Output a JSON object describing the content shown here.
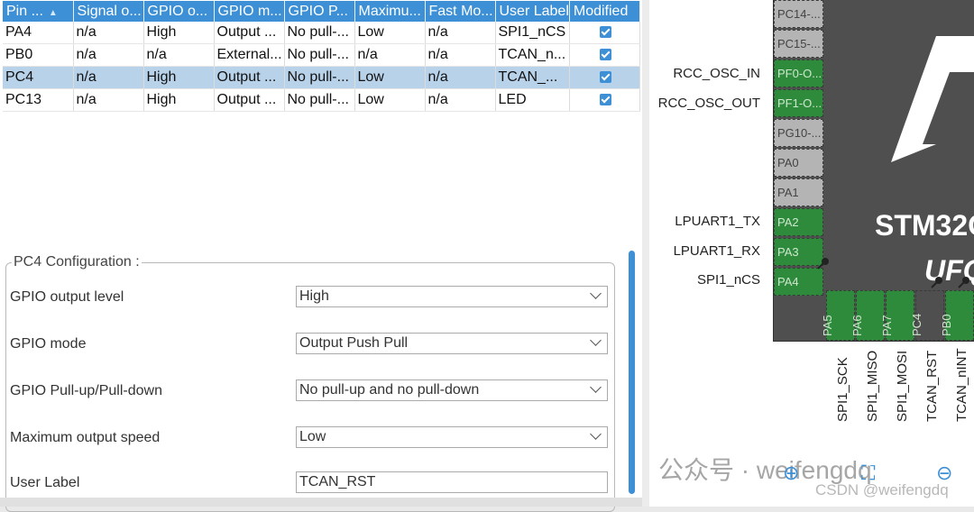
{
  "table": {
    "headers": [
      "Pin ...",
      "Signal o...",
      "GPIO o...",
      "GPIO m...",
      "GPIO P...",
      "Maximu...",
      "Fast Mo...",
      "User Label",
      "Modified"
    ],
    "rows": [
      {
        "pin": "PA4",
        "signal": "n/a",
        "out": "High",
        "mode": "Output ...",
        "pull": "No pull-...",
        "max": "Low",
        "fast": "n/a",
        "label": "SPI1_nCS"
      },
      {
        "pin": "PB0",
        "signal": "n/a",
        "out": "n/a",
        "mode": "External...",
        "pull": "No pull-...",
        "max": "n/a",
        "fast": "n/a",
        "label": "TCAN_n..."
      },
      {
        "pin": "PC4",
        "signal": "n/a",
        "out": "High",
        "mode": "Output ...",
        "pull": "No pull-...",
        "max": "Low",
        "fast": "n/a",
        "label": "TCAN_..."
      },
      {
        "pin": "PC13",
        "signal": "n/a",
        "out": "High",
        "mode": "Output ...",
        "pull": "No pull-...",
        "max": "Low",
        "fast": "n/a",
        "label": "LED"
      }
    ]
  },
  "config": {
    "title": "PC4 Configuration :",
    "fields": [
      {
        "label": "GPIO output level",
        "value": "High"
      },
      {
        "label": "GPIO mode",
        "value": "Output Push Pull"
      },
      {
        "label": "GPIO Pull-up/Pull-down",
        "value": "No pull-up and no pull-down"
      },
      {
        "label": "Maximum output speed",
        "value": "Low"
      },
      {
        "label": "User Label",
        "value": "TCAN_RST"
      }
    ]
  },
  "chip": {
    "name": "STM32G",
    "name2": "UFQ",
    "left_pins": [
      "PC14-...",
      "PC15-...",
      "PF0-O...",
      "PF1-O...",
      "PG10-...",
      "PA0",
      "PA1",
      "PA2",
      "PA3",
      "PA4"
    ],
    "left_labels": [
      "RCC_OSC_IN",
      "RCC_OSC_OUT",
      "LPUART1_TX",
      "LPUART1_RX",
      "SPI1_nCS"
    ],
    "bottom_pins": [
      "PA5",
      "PA6",
      "PA7",
      "PC4",
      "PB0"
    ],
    "bottom_labels": [
      "SPI1_SCK",
      "SPI1_MISO",
      "SPI1_MOSI",
      "TCAN_RST",
      "TCAN_nINT"
    ]
  },
  "watermark": {
    "main": "公众号 · weifengdq",
    "sub": "CSDN @weifengdq"
  },
  "colors": {
    "header": "#3d8fd6",
    "selected_row": "#b8d2ea",
    "pin_green": "#2e8b3c",
    "chip_body": "#4f4f4f"
  }
}
